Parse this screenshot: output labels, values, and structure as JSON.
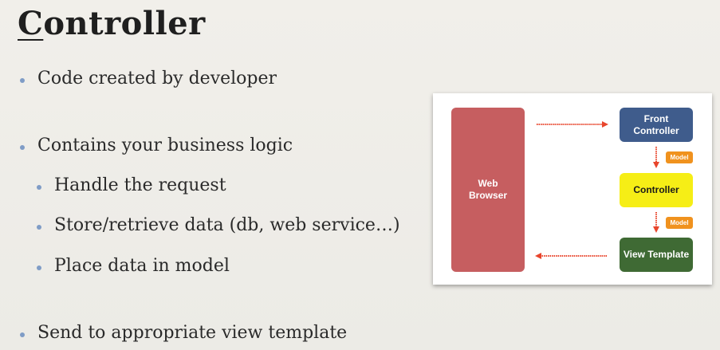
{
  "slide": {
    "title_first": "C",
    "title_rest": "ontroller",
    "bullets": [
      "Code created by developer",
      "Contains your business logic",
      "Handle the request",
      "Store/retrieve data (db, web service…)",
      "Place data in model",
      "Send to appropriate view template"
    ]
  },
  "diagram": {
    "browser_line1": "Web",
    "browser_line2": "Browser",
    "front_line1": "Front",
    "front_line2": "Controller",
    "controller": "Controller",
    "view_template": "View Template",
    "model_badge_1": "Model",
    "model_badge_2": "Model",
    "colors": {
      "browser": "#c65e60",
      "front_controller": "#3f5c8c",
      "controller": "#f6ee16",
      "view_template": "#3f6a34",
      "model_badge": "#f0921e",
      "arrow": "#e8452c",
      "bullet_dot": "#7f9cc6"
    }
  }
}
